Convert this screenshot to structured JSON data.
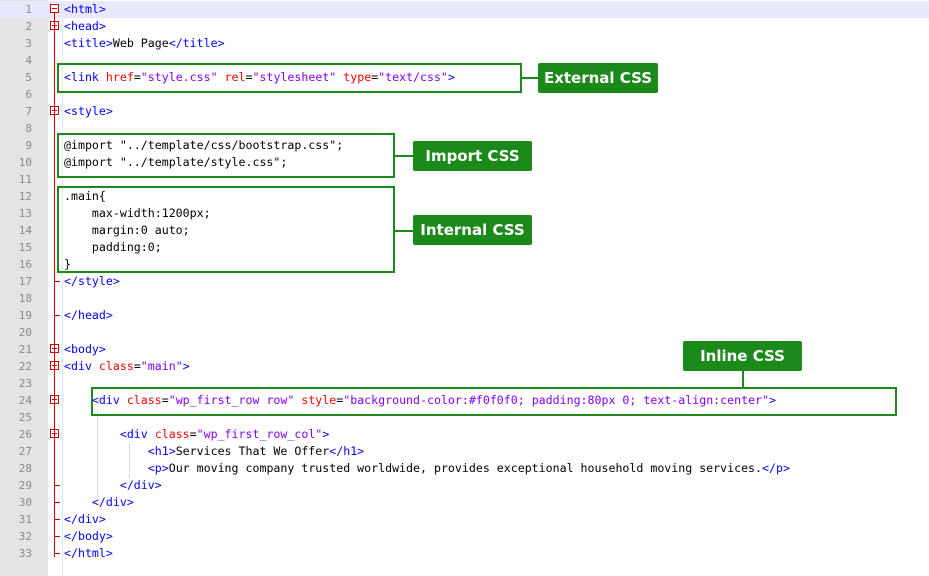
{
  "editor": {
    "lines": [
      {
        "n": "1",
        "tokens": [
          {
            "c": "t",
            "s": "<html>"
          }
        ]
      },
      {
        "n": "2",
        "tokens": [
          {
            "c": "t",
            "s": "<head>"
          }
        ]
      },
      {
        "n": "3",
        "tokens": [
          {
            "c": "t",
            "s": "<title>"
          },
          {
            "c": "k",
            "s": "Web Page"
          },
          {
            "c": "t",
            "s": "</title>"
          }
        ]
      },
      {
        "n": "4",
        "tokens": []
      },
      {
        "n": "5",
        "tokens": [
          {
            "c": "t",
            "s": "<link "
          },
          {
            "c": "a",
            "s": "href"
          },
          {
            "c": "k",
            "s": "="
          },
          {
            "c": "v",
            "s": "\"style.css\""
          },
          {
            "c": "k",
            "s": " "
          },
          {
            "c": "a",
            "s": "rel"
          },
          {
            "c": "k",
            "s": "="
          },
          {
            "c": "v",
            "s": "\"stylesheet\""
          },
          {
            "c": "k",
            "s": " "
          },
          {
            "c": "a",
            "s": "type"
          },
          {
            "c": "k",
            "s": "="
          },
          {
            "c": "v",
            "s": "\"text/css\""
          },
          {
            "c": "t",
            "s": ">"
          }
        ]
      },
      {
        "n": "6",
        "tokens": []
      },
      {
        "n": "7",
        "tokens": [
          {
            "c": "t",
            "s": "<style>"
          }
        ]
      },
      {
        "n": "8",
        "tokens": []
      },
      {
        "n": "9",
        "tokens": [
          {
            "c": "k",
            "s": "@import \"../template/css/bootstrap.css\";"
          }
        ]
      },
      {
        "n": "10",
        "tokens": [
          {
            "c": "k",
            "s": "@import \"../template/style.css\";"
          }
        ]
      },
      {
        "n": "11",
        "tokens": []
      },
      {
        "n": "12",
        "tokens": [
          {
            "c": "k",
            "s": ".main{"
          }
        ]
      },
      {
        "n": "13",
        "tokens": [
          {
            "c": "k",
            "s": "    max-width:1200px;"
          }
        ]
      },
      {
        "n": "14",
        "tokens": [
          {
            "c": "k",
            "s": "    margin:0 auto;"
          }
        ]
      },
      {
        "n": "15",
        "tokens": [
          {
            "c": "k",
            "s": "    padding:0;"
          }
        ]
      },
      {
        "n": "16",
        "tokens": [
          {
            "c": "k",
            "s": "}"
          }
        ]
      },
      {
        "n": "17",
        "tokens": [
          {
            "c": "t",
            "s": "</style>"
          }
        ]
      },
      {
        "n": "18",
        "tokens": []
      },
      {
        "n": "19",
        "tokens": [
          {
            "c": "t",
            "s": "</head>"
          }
        ]
      },
      {
        "n": "20",
        "tokens": []
      },
      {
        "n": "21",
        "tokens": [
          {
            "c": "t",
            "s": "<body>"
          }
        ]
      },
      {
        "n": "22",
        "tokens": [
          {
            "c": "t",
            "s": "<div "
          },
          {
            "c": "a",
            "s": "class"
          },
          {
            "c": "k",
            "s": "="
          },
          {
            "c": "v",
            "s": "\"main\""
          },
          {
            "c": "t",
            "s": ">"
          }
        ]
      },
      {
        "n": "23",
        "tokens": []
      },
      {
        "n": "24",
        "tokens": [
          {
            "c": "k",
            "s": "    "
          },
          {
            "c": "t",
            "s": "<div "
          },
          {
            "c": "a",
            "s": "class"
          },
          {
            "c": "k",
            "s": "="
          },
          {
            "c": "v",
            "s": "\"wp_first_row row\""
          },
          {
            "c": "k",
            "s": " "
          },
          {
            "c": "a",
            "s": "style"
          },
          {
            "c": "k",
            "s": "="
          },
          {
            "c": "v",
            "s": "\"background-color:#f0f0f0; padding:80px 0; text-align:center\""
          },
          {
            "c": "t",
            "s": ">"
          }
        ]
      },
      {
        "n": "25",
        "tokens": []
      },
      {
        "n": "26",
        "tokens": [
          {
            "c": "k",
            "s": "        "
          },
          {
            "c": "t",
            "s": "<div "
          },
          {
            "c": "a",
            "s": "class"
          },
          {
            "c": "k",
            "s": "="
          },
          {
            "c": "v",
            "s": "\"wp_first_row_col\""
          },
          {
            "c": "t",
            "s": ">"
          }
        ]
      },
      {
        "n": "27",
        "tokens": [
          {
            "c": "k",
            "s": "            "
          },
          {
            "c": "t",
            "s": "<h1>"
          },
          {
            "c": "k",
            "s": "Services That We Offer"
          },
          {
            "c": "t",
            "s": "</h1>"
          }
        ]
      },
      {
        "n": "28",
        "tokens": [
          {
            "c": "k",
            "s": "            "
          },
          {
            "c": "t",
            "s": "<p>"
          },
          {
            "c": "k",
            "s": "Our moving company trusted worldwide, provides exceptional household moving services."
          },
          {
            "c": "t",
            "s": "</p>"
          }
        ]
      },
      {
        "n": "29",
        "tokens": [
          {
            "c": "k",
            "s": "        "
          },
          {
            "c": "t",
            "s": "</div>"
          }
        ]
      },
      {
        "n": "30",
        "tokens": [
          {
            "c": "k",
            "s": "    "
          },
          {
            "c": "t",
            "s": "</div>"
          }
        ]
      },
      {
        "n": "31",
        "tokens": [
          {
            "c": "t",
            "s": "</div>"
          }
        ]
      },
      {
        "n": "32",
        "tokens": [
          {
            "c": "t",
            "s": "</body>"
          }
        ]
      },
      {
        "n": "33",
        "tokens": [
          {
            "c": "t",
            "s": "</html>"
          }
        ]
      }
    ]
  },
  "annotations": {
    "external": "External CSS",
    "import": "Import CSS",
    "internal": "Internal CSS",
    "inline": "Inline CSS"
  },
  "colors": {
    "tag": "#0000ff",
    "attribute": "#ff0000",
    "value": "#8000ff",
    "annotation_bg": "#1b8a1b",
    "fold_marker": "#d00000"
  }
}
